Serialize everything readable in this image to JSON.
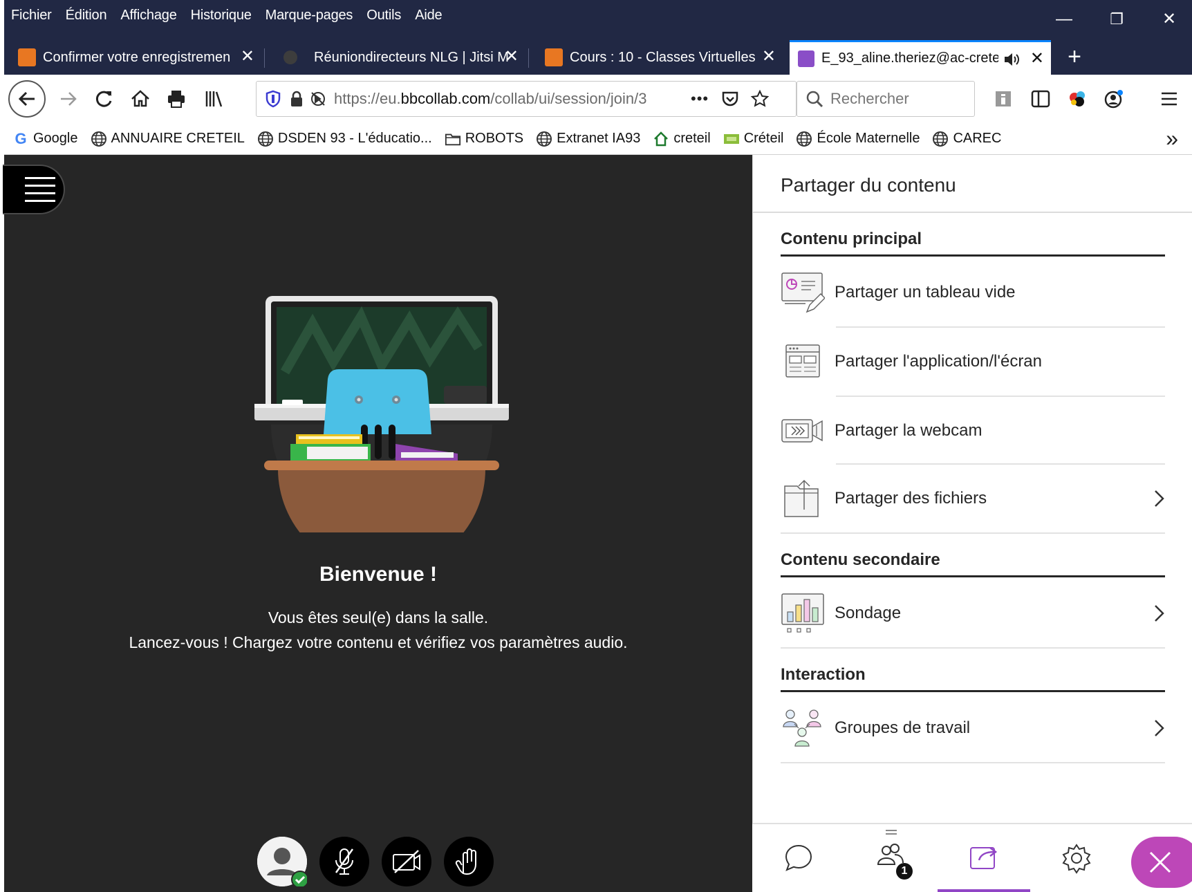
{
  "menubar": {
    "items": [
      "Fichier",
      "Édition",
      "Affichage",
      "Historique",
      "Marque-pages",
      "Outils",
      "Aide"
    ]
  },
  "window_controls": {
    "minimize": "—",
    "restore": "❐",
    "close": "✕"
  },
  "tabs": [
    {
      "label": "Confirmer votre enregistremen",
      "favicon_color": "#e87722"
    },
    {
      "label": "Réuniondirecteurs NLG | Jitsi M",
      "favicon_color": "#3d3d3d"
    },
    {
      "label": "Cours : 10 - Classes Virtuelles",
      "favicon_color": "#e87722"
    },
    {
      "label": "E_93_aline.theriez@ac-crete",
      "favicon_color": "#8a4ec7",
      "active": true
    }
  ],
  "tab_close_glyph": "✕",
  "new_tab_glyph": "+",
  "navbar": {
    "url_prefix": "https://eu.",
    "url_domain": "bbcollab.com",
    "url_path": "/collab/ui/session/join/3",
    "url_more": "•••",
    "search_placeholder": "Rechercher"
  },
  "bookmarks": [
    {
      "label": "Google",
      "icon": "google-icon"
    },
    {
      "label": "ANNUAIRE CRETEIL",
      "icon": "globe-icon"
    },
    {
      "label": "DSDEN 93 - L'éducatio...",
      "icon": "globe-icon"
    },
    {
      "label": "ROBOTS",
      "icon": "folder-icon"
    },
    {
      "label": "Extranet IA93",
      "icon": "globe-icon"
    },
    {
      "label": "creteil",
      "icon": "house-icon"
    },
    {
      "label": "Créteil",
      "icon": "image-icon"
    },
    {
      "label": "École Maternelle",
      "icon": "globe-icon"
    },
    {
      "label": "CAREC",
      "icon": "globe-icon"
    }
  ],
  "bookmarks_overflow": "»",
  "stage": {
    "welcome_title": "Bienvenue !",
    "welcome_line1": "Vous êtes seul(e) dans la salle.",
    "welcome_line2": "Lancez-vous ! Chargez votre contenu et vérifiez vos paramètres audio."
  },
  "panel": {
    "title": "Partager du contenu",
    "sections": {
      "main": "Contenu principal",
      "secondary": "Contenu secondaire",
      "interaction": "Interaction"
    },
    "items": {
      "whiteboard": "Partager un tableau vide",
      "app_screen": "Partager l'application/l'écran",
      "webcam": "Partager la webcam",
      "files": "Partager des fichiers",
      "poll": "Sondage",
      "groups": "Groupes de travail"
    }
  },
  "tabbar": {
    "attendees_badge": "1"
  },
  "colors": {
    "titlebar": "#212844",
    "stage": "#262626",
    "accent": "#9146c6",
    "close": "#bd47b8",
    "status_ok": "#2ea043"
  }
}
